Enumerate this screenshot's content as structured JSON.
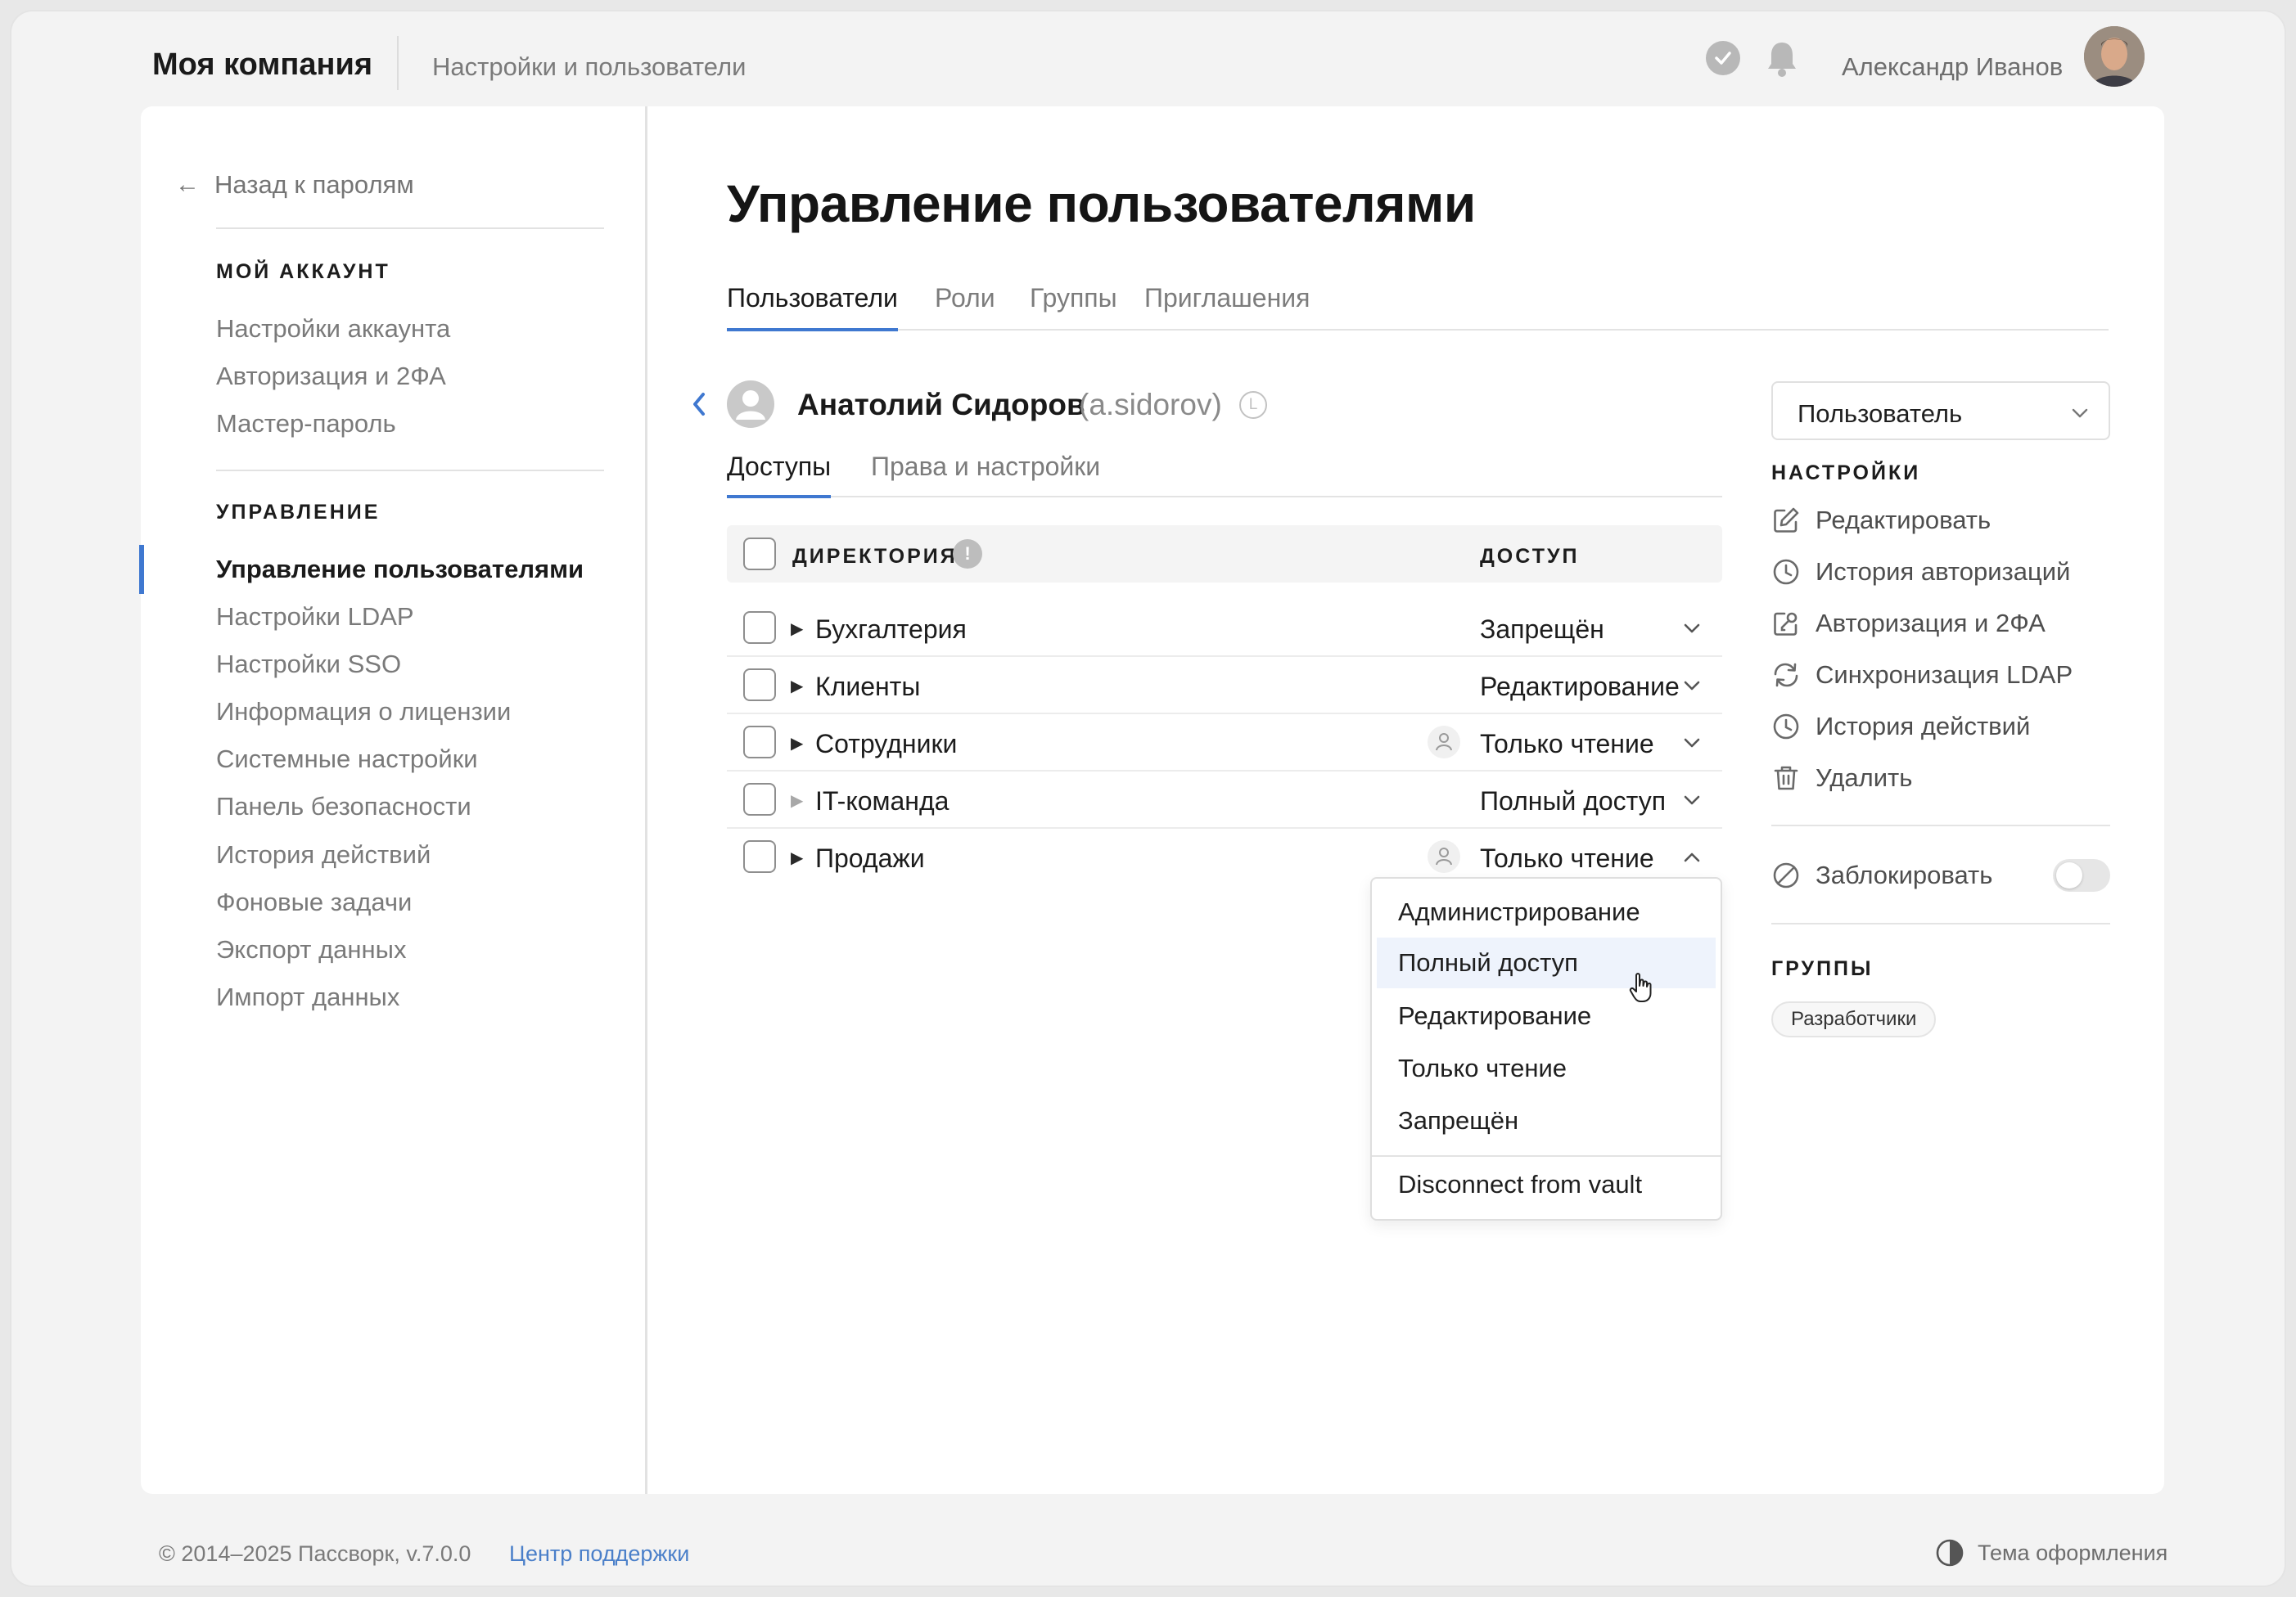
{
  "header": {
    "brand": "Моя компания",
    "section": "Настройки и пользователи",
    "user_name": "Александр Иванов",
    "icons": [
      "check-circle-icon",
      "bell-icon"
    ]
  },
  "sidebar": {
    "back_label": "Назад к паролям",
    "account_heading": "МОЙ АККАУНТ",
    "account_items": [
      "Настройки аккаунта",
      "Авторизация и 2ФА",
      "Мастер-пароль"
    ],
    "management_heading": "УПРАВЛЕНИЕ",
    "management_items": [
      "Управление пользователями",
      "Настройки LDAP",
      "Настройки SSO",
      "Информация о лицензии",
      "Системные настройки",
      "Панель безопасности",
      "История действий",
      "Фоновые задачи",
      "Экспорт данных",
      "Импорт данных"
    ],
    "active_item": "Управление пользователями",
    "accent_color": "#3f78d0"
  },
  "main": {
    "title": "Управление пользователями",
    "tabs": [
      "Пользователи",
      "Роли",
      "Группы",
      "Приглашения"
    ],
    "active_tab": "Пользователи",
    "user": {
      "name": "Анатолий Сидоров",
      "login": "(a.sidorov)",
      "badge": "L"
    },
    "subtabs": [
      "Доступы",
      "Права и настройки"
    ],
    "active_subtab": "Доступы",
    "table": {
      "col_directory": "ДИРЕКТОРИЯ",
      "col_access": "ДОСТУП",
      "info_glyph": "!",
      "rows": [
        {
          "name": "Бухгалтерия",
          "access": "Запрещён",
          "inherited": false
        },
        {
          "name": "Клиенты",
          "access": "Редактирование",
          "inherited": false
        },
        {
          "name": "Сотрудники",
          "access": "Только чтение",
          "inherited": true
        },
        {
          "name": "IT-команда",
          "access": "Полный доступ",
          "inherited": false
        },
        {
          "name": "Продажи",
          "access": "Только чтение",
          "inherited": true
        }
      ]
    },
    "access_menu": {
      "options": [
        "Администрирование",
        "Полный доступ",
        "Редактирование",
        "Только чтение",
        "Запрещён"
      ],
      "highlighted": "Полный доступ",
      "extra": "Disconnect from vault"
    }
  },
  "right_panel": {
    "role_select": "Пользователь",
    "settings_heading": "НАСТРОЙКИ",
    "actions": [
      {
        "label": "Редактировать",
        "icon": "edit-icon"
      },
      {
        "label": "История авторизаций",
        "icon": "clock-icon"
      },
      {
        "label": "Авторизация и 2ФА",
        "icon": "edit-key-icon"
      },
      {
        "label": "Синхронизация LDAP",
        "icon": "sync-icon"
      },
      {
        "label": "История действий",
        "icon": "clock-icon"
      },
      {
        "label": "Удалить",
        "icon": "trash-icon"
      }
    ],
    "block_label": "Заблокировать",
    "block_enabled": false,
    "groups_heading": "ГРУППЫ",
    "groups": [
      "Разработчики"
    ]
  },
  "footer": {
    "copyright": "© 2014–2025 Пассворк, v.7.0.0",
    "support_link": "Центр поддержки",
    "theme_label": "Тема оформления"
  }
}
